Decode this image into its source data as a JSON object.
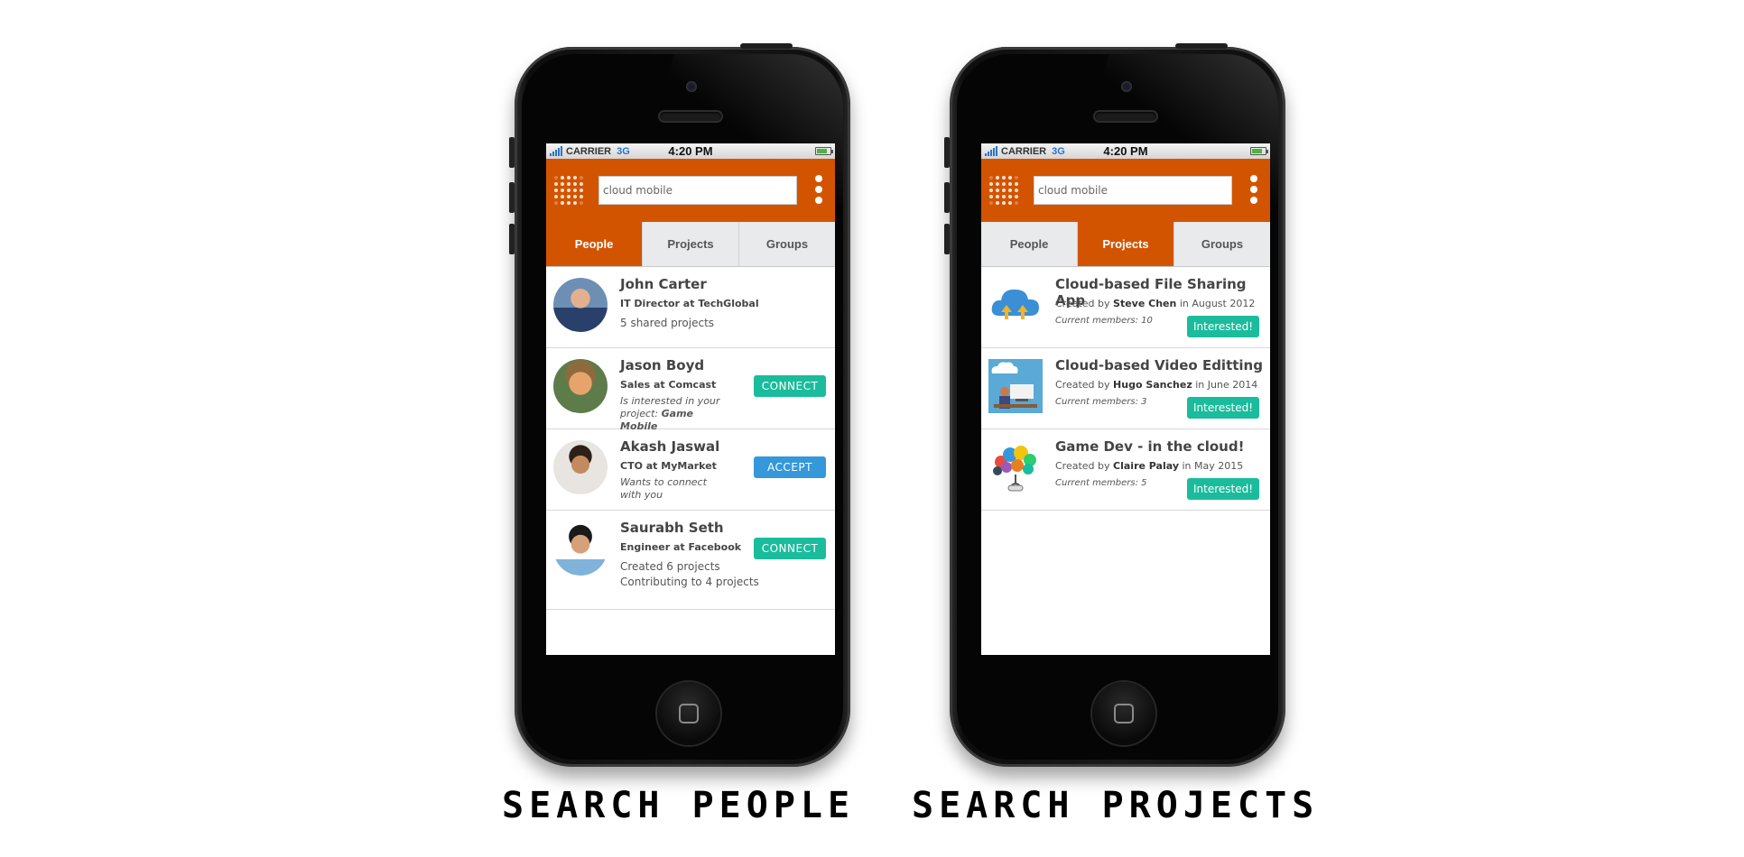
{
  "phones": [
    {
      "status": {
        "carrier": "CARRIER",
        "network": "3G",
        "time": "4:20 PM"
      },
      "search": {
        "value": "cloud mobile"
      },
      "tabs": [
        "People",
        "Projects",
        "Groups"
      ],
      "active_tab": "People",
      "people": [
        {
          "name": "John Carter",
          "role": "IT Director at TechGlobal",
          "extra": "5 shared projects",
          "action": ""
        },
        {
          "name": "Jason Boyd",
          "role": "Sales at Comcast",
          "note_prefix": "Is interested in your project: ",
          "note_highlight": "Game Mobile",
          "action": "CONNECT"
        },
        {
          "name": "Akash Jaswal",
          "role": "CTO at MyMarket",
          "note_prefix": "Wants to connect with you",
          "note_highlight": "",
          "action": "ACCEPT"
        },
        {
          "name": "Saurabh Seth",
          "role": "Engineer at Facebook",
          "extra_line1": "Created 6 projects",
          "extra_line2": "Contributing to 4 projects",
          "action": "CONNECT"
        }
      ]
    },
    {
      "status": {
        "carrier": "CARRIER",
        "network": "3G",
        "time": "4:20 PM"
      },
      "search": {
        "value": "cloud mobile"
      },
      "tabs": [
        "People",
        "Projects",
        "Groups"
      ],
      "active_tab": "Projects",
      "projects": [
        {
          "title": "Cloud-based File Sharing App",
          "created_prefix": "Created by ",
          "creator": "Steve Chen",
          "created_suffix": " in August 2012",
          "members": "Current members: 10",
          "action": "Interested!"
        },
        {
          "title": "Cloud-based Video Editting",
          "created_prefix": "Created by ",
          "creator": "Hugo Sanchez",
          "created_suffix": " in June 2014",
          "members": "Current members: 3",
          "action": "Interested!"
        },
        {
          "title": "Game Dev - in the cloud!",
          "created_prefix": "Created by ",
          "creator": "Claire Palay",
          "created_suffix": " in May 2015",
          "members": "Current members: 5",
          "action": "Interested!"
        }
      ]
    }
  ],
  "captions": {
    "left": "SEARCH PEOPLE",
    "right": "SEARCH PROJECTS"
  },
  "colors": {
    "accent": "#d35400",
    "teal": "#1abc9c",
    "blue": "#3498db"
  }
}
